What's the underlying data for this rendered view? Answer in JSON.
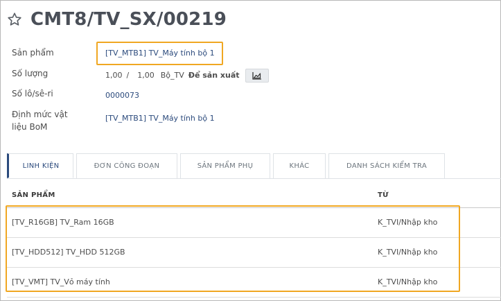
{
  "record": {
    "title": "CMT8/TV_SX/00219"
  },
  "fields": {
    "product": {
      "label": "Sản phẩm",
      "value": "[TV_MTB1] TV_Máy tính bộ 1"
    },
    "quantity": {
      "label": "Số lượng",
      "produced": "1,00",
      "separator": "/",
      "planned": "1,00",
      "uom": "Bộ_TV",
      "action": "Để sản xuất"
    },
    "lot": {
      "label": "Số lô/sê-ri",
      "value": "0000073"
    },
    "bom": {
      "label_line1": "Định mức vật",
      "label_line2": "liệu BoM",
      "value": "[TV_MTB1] TV_Máy tính bộ 1"
    }
  },
  "tabs": [
    {
      "label": "LINH KIỆN",
      "active": true
    },
    {
      "label": "ĐƠN CÔNG ĐOẠN",
      "active": false
    },
    {
      "label": "SẢN PHẨM PHỤ",
      "active": false
    },
    {
      "label": "KHÁC",
      "active": false
    },
    {
      "label": "DANH SÁCH KIỂM TRA",
      "active": false
    }
  ],
  "table": {
    "columns": [
      "SẢN PHẨM",
      "TỪ"
    ],
    "rows": [
      {
        "product": "[TV_R16GB] TV_Ram 16GB",
        "from": "K_TVI/Nhập kho"
      },
      {
        "product": "[TV_HDD512] TV_HDD 512GB",
        "from": "K_TVI/Nhập kho"
      },
      {
        "product": "[TV_VMT] TV_Vỏ máy tính",
        "from": "K_TVI/Nhập kho"
      }
    ]
  },
  "colors": {
    "highlight": "#f0a722",
    "accent": "#2b4a7c",
    "text": "#4c4c4c"
  },
  "icons": {
    "favorite": "star-outline-icon",
    "forecast": "area-chart-icon"
  }
}
